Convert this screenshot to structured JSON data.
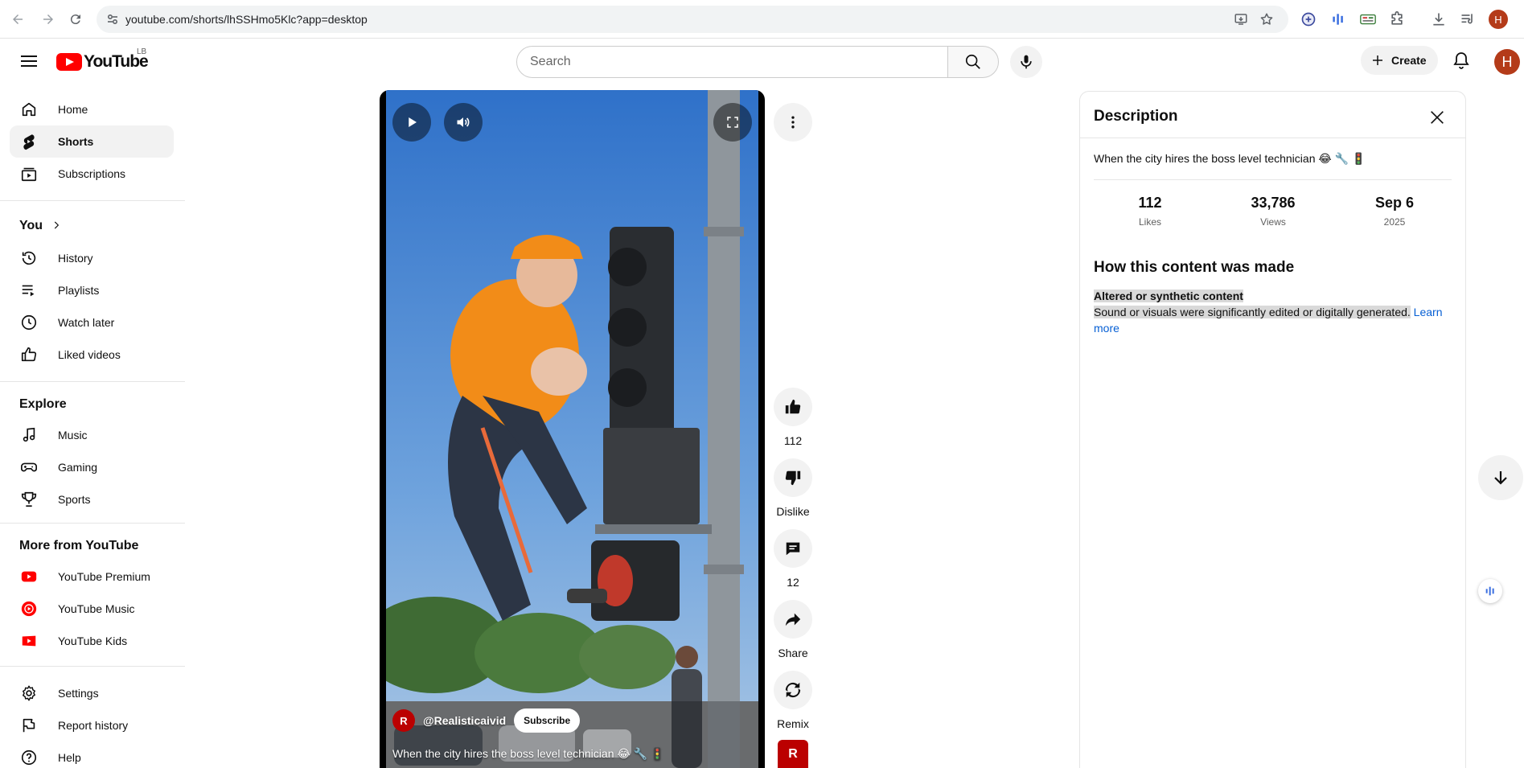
{
  "browser": {
    "url": "youtube.com/shorts/lhSSHmo5Klc?app=desktop",
    "profile_initial": "H"
  },
  "header": {
    "logo_text": "YouTube",
    "country_code": "LB",
    "search_placeholder": "Search",
    "create_label": "Create",
    "avatar_initial": "H"
  },
  "sidebar": {
    "main": [
      {
        "label": "Home",
        "icon": "home-icon"
      },
      {
        "label": "Shorts",
        "icon": "shorts-icon",
        "active": true
      },
      {
        "label": "Subscriptions",
        "icon": "subscriptions-icon"
      }
    ],
    "you_title": "You",
    "you": [
      {
        "label": "History",
        "icon": "history-icon"
      },
      {
        "label": "Playlists",
        "icon": "playlists-icon"
      },
      {
        "label": "Watch later",
        "icon": "clock-icon"
      },
      {
        "label": "Liked videos",
        "icon": "thumb-up-icon"
      }
    ],
    "explore_title": "Explore",
    "explore": [
      {
        "label": "Music",
        "icon": "music-note-icon"
      },
      {
        "label": "Gaming",
        "icon": "gamepad-icon"
      },
      {
        "label": "Sports",
        "icon": "trophy-icon"
      }
    ],
    "more_title": "More from YouTube",
    "more": [
      {
        "label": "YouTube Premium",
        "icon": "youtube-premium-icon"
      },
      {
        "label": "YouTube Music",
        "icon": "youtube-music-icon"
      },
      {
        "label": "YouTube Kids",
        "icon": "youtube-kids-icon"
      }
    ],
    "footer": [
      {
        "label": "Settings",
        "icon": "gear-icon"
      },
      {
        "label": "Report history",
        "icon": "flag-icon"
      },
      {
        "label": "Help",
        "icon": "help-icon"
      }
    ]
  },
  "short": {
    "channel": "@Realisticaivid",
    "channel_initial": "R",
    "subscribe_label": "Subscribe",
    "caption": "When the city hires the boss level technician 😂 🔧 🚦"
  },
  "actions": {
    "like_count": "112",
    "dislike_label": "Dislike",
    "comment_count": "12",
    "share_label": "Share",
    "remix_label": "Remix"
  },
  "description": {
    "title": "Description",
    "text": "When the city hires the boss level technician 😂 🔧 🚦",
    "stats": [
      {
        "value": "112",
        "label": "Likes"
      },
      {
        "value": "33,786",
        "label": "Views"
      },
      {
        "value": "Sep 6",
        "label": "2025"
      }
    ],
    "how_title": "How this content was made",
    "alt_title": "Altered or synthetic content",
    "alt_text": "Sound or visuals were significantly edited or digitally generated.",
    "learn_more": "Learn more"
  },
  "colors": {
    "brand_red": "#ff0000",
    "link_blue": "#065fd4",
    "avatar_bg": "#b43b19"
  }
}
